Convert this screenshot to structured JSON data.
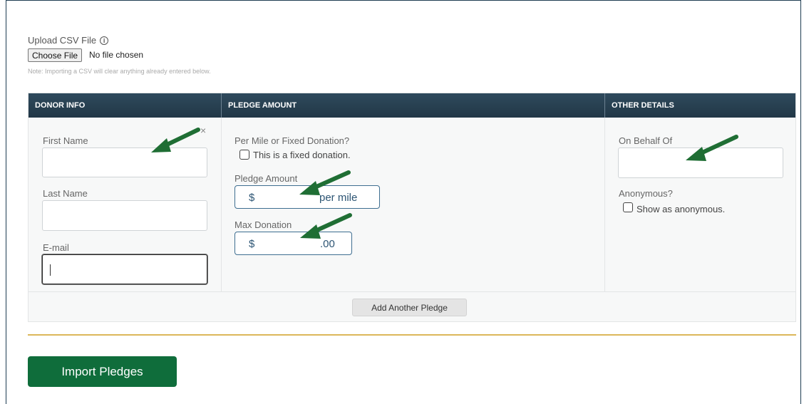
{
  "upload": {
    "label": "Upload CSV File",
    "info_icon": "i",
    "choose_button": "Choose File",
    "no_file": "No file chosen",
    "note": "Note: Importing a CSV will clear anything already entered below."
  },
  "table": {
    "headers": [
      "DONOR INFO",
      "PLEDGE AMOUNT",
      "OTHER DETAILS"
    ],
    "donor": {
      "first_name_label": "First Name",
      "first_name_value": "",
      "last_name_label": "Last Name",
      "last_name_value": "",
      "email_label": "E-mail",
      "email_value": "",
      "remove_icon": "×"
    },
    "pledge": {
      "type_label": "Per Mile or Fixed Donation?",
      "fixed_checkbox_label": "This is a fixed donation.",
      "fixed_checked": false,
      "amount_label": "Pledge Amount",
      "amount_prefix": "$",
      "amount_suffix": "per mile",
      "max_label": "Max Donation",
      "max_prefix": "$",
      "max_suffix": ".00"
    },
    "other": {
      "on_behalf_label": "On Behalf Of",
      "on_behalf_value": "",
      "anonymous_label": "Anonymous?",
      "anonymous_checkbox_label": "Show as anonymous.",
      "anonymous_checked": false
    },
    "add_button": "Add Another Pledge"
  },
  "import_button": "Import Pledges",
  "colors": {
    "header_bg": "#263f51",
    "accent_green": "#0f6d3b",
    "gold_rule": "#dcb75a",
    "arrow": "#1f6e34"
  }
}
